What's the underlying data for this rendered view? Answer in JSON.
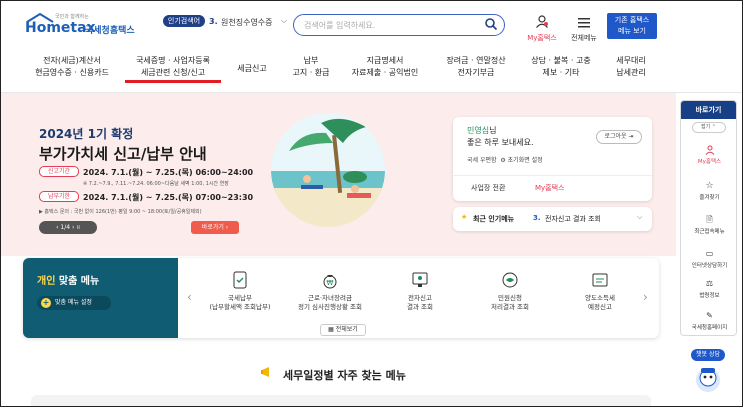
{
  "header": {
    "logo_tagline": "국민과 함께하는",
    "logo_name": "Hometax",
    "logo_korean": "국세청홈택스",
    "popular_badge": "인기검색어",
    "popular_rank": "3.",
    "popular_term": "원천징수영수증",
    "search_placeholder": "검색어를 입력하세요.",
    "my_hometax": "My홈택스",
    "all_menu": "전체메뉴",
    "classic_btn_line1": "기존 홈택스",
    "classic_btn_line2": "메뉴 보기"
  },
  "nav": [
    {
      "l1": "전자(세금)계산서",
      "l2": "현금영수증 · 신용카드"
    },
    {
      "l1": "국세증명 · 사업자등록",
      "l2": "세금관련 신청/신고"
    },
    {
      "l1": "세금신고",
      "l2": ""
    },
    {
      "l1": "납부",
      "l2": "고지 · 환급"
    },
    {
      "l1": "지급명세서",
      "l2": "자료제출 · 공익법인"
    },
    {
      "l1": "장려금 · 연말정산",
      "l2": "전자기부금"
    },
    {
      "l1": "상담 · 불복 · 고충",
      "l2": "제보 · 기타"
    },
    {
      "l1": "세무대리",
      "l2": "납세관리"
    }
  ],
  "hero": {
    "subtitle": "2024년 1기 확정",
    "title": "부가가치세 신고/납부 안내",
    "report_label": "신고기간",
    "report_value": "2024. 7.1.(월) ~ 7.25.(목) 06:00~24:00",
    "report_note": "※ 7.2.~7.9., 7.11.~7.24. 06:00~다음날 새벽 1:00, 1시간 연장",
    "pay_label": "납부기한",
    "pay_value": "2024. 7.1.(월) ~ 7.25.(목) 07:00~23:30",
    "contact_note": "▶ 홈택스 문의 : 국번 없이 126(1번) 평일 9:00 ~ 18:00(토/일/공휴일제외)",
    "pager": "1/4",
    "shortcut": "바로가기"
  },
  "user": {
    "name": "민영심",
    "suffix": "님",
    "greeting": "좋은 하루 보내세요.",
    "logout": "로그아웃",
    "mailbox": "국세 우편함",
    "initial_screen": "초기화면 설정",
    "switch_business": "사업장 전환",
    "my_hometax": "My홈택스"
  },
  "favorites": {
    "label": "최근 인기메뉴",
    "rank": "3.",
    "item": "전자신고 결과 조회"
  },
  "sidebar": {
    "title": "바로가기",
    "fold": "접기",
    "items": [
      "My홈택스",
      "즐겨찾기",
      "최근접속메뉴",
      "인터넷상담하기",
      "법령정보",
      "국세청홈페이지"
    ],
    "chatbot": "챗봇 상담"
  },
  "personal_menu": {
    "title_a": "개인",
    "title_b": "맞춤 메뉴",
    "setting": "맞춤 메뉴 설정",
    "cards": [
      {
        "l1": "국세납부",
        "l2": "(납부할세액 조회납부)"
      },
      {
        "l1": "근로·자녀장려금",
        "l2": "정기 심사진행상황 조회"
      },
      {
        "l1": "전자신고",
        "l2": "결과 조회"
      },
      {
        "l1": "민원신청",
        "l2": "처리결과 조회"
      },
      {
        "l1": "양도소득세",
        "l2": "예정신고"
      }
    ],
    "view_all": "전체보기"
  },
  "faq_title": "세무일정별 자주 찾는 메뉴",
  "colors": {
    "brand": "#1d5fb6",
    "nav_active": "#e31b23",
    "hero_bg": "#fcecec",
    "teal": "#0f5c73",
    "accent_red": "#e63c54"
  }
}
